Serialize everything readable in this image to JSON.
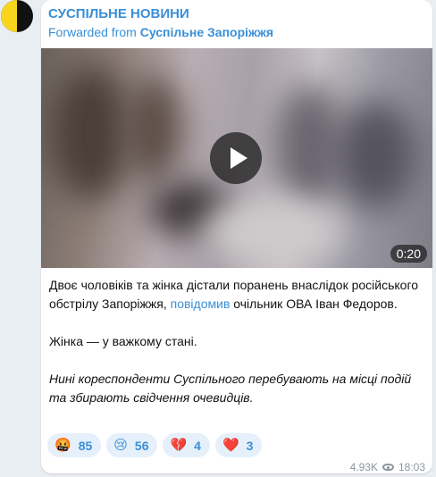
{
  "channel": {
    "name": "СУСПІЛЬНЕ НОВИНИ",
    "forwarded_prefix": "Forwarded from",
    "forwarded_source": "Суспільне Запоріжжя",
    "avatar_colors": [
      "#f7d51d",
      "#111111"
    ]
  },
  "video": {
    "duration": "0:20",
    "play_icon": "play-icon"
  },
  "message": {
    "p1_part1": "Двоє чоловіків та жінка дістали поранень внаслідок російського обстрілу Запоріжжя, ",
    "p1_link": "повідомив",
    "p1_part2": " очільник ОВА Іван Федоров.",
    "p2": "Жінка — у важкому стані.",
    "p3": "Нині кореспонденти Суспільного перебувають на місці подій та збирають свідчення очевидців."
  },
  "reactions": [
    {
      "emoji": "🤬",
      "icon": "angry-face-icon",
      "count": "85"
    },
    {
      "emoji": "😢",
      "icon": "crying-face-icon",
      "count": "56"
    },
    {
      "emoji": "💔",
      "icon": "broken-heart-icon",
      "count": "4"
    },
    {
      "emoji": "❤️",
      "icon": "heart-icon",
      "count": "3"
    }
  ],
  "meta": {
    "views": "4.93K",
    "time": "18:03"
  },
  "colors": {
    "accent": "#3a8fd8",
    "background": "#e9eef3",
    "reaction_bg": "#e5f0fa"
  }
}
